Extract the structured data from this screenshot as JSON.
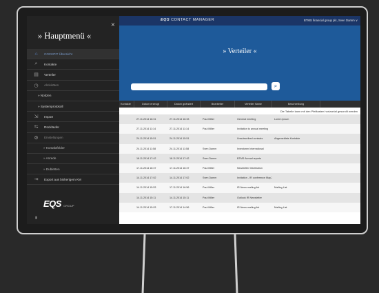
{
  "sidebar": {
    "title": "» Hauptmenü «",
    "close": "×",
    "items": [
      {
        "label": "COCKPIT Übersicht",
        "icon": "home-icon",
        "level": 0,
        "active": true
      },
      {
        "label": "Kontakte",
        "icon": "search-icon",
        "level": 0
      },
      {
        "label": "Verteiler",
        "icon": "list-icon",
        "level": 0
      },
      {
        "label": "Aktivitäten",
        "icon": "clock-icon",
        "level": 0,
        "dim": true
      },
      {
        "label": "» Notizen",
        "icon": "",
        "level": 1
      },
      {
        "label": "» Systemprotokoll",
        "icon": "",
        "level": 1
      },
      {
        "label": "Import",
        "icon": "import-icon",
        "level": 0
      },
      {
        "label": "Rückläufer",
        "icon": "bounce-icon",
        "level": 0
      },
      {
        "label": "Einstellungen",
        "icon": "gear-icon",
        "level": 0,
        "dim": true
      },
      {
        "label": "» Kontaktfelder",
        "icon": "",
        "level": 2
      },
      {
        "label": "» Anrede",
        "icon": "",
        "level": 2
      },
      {
        "label": "» Dubletten",
        "icon": "",
        "level": 2
      },
      {
        "label": "Export aus bisherigem KM",
        "icon": "export-icon",
        "level": 0
      }
    ],
    "logo": "EQS",
    "logo_sub": "GROUP"
  },
  "topbar": {
    "brand_bold": "EQS",
    "brand_rest": "CONTACT MANAGER",
    "user": "BTMS financial group plc, Sven Damm ∨"
  },
  "banner": {
    "title": "» Verteiler «",
    "search_placeholder": "",
    "search_icon": "🔍"
  },
  "table": {
    "headers": [
      "Kontakte",
      "Datum erzeugt",
      "Datum geändert",
      "Bearbeiter",
      "Verteiler Name",
      "Beschreibung"
    ],
    "notice": "Die Tabelle kann mit den Pfeiltasten horizontal gescrollt werden",
    "rows": [
      [
        "",
        "27.11.2014 16:31",
        "27.11.2014 16:33",
        "Paul Miller",
        "General meeting",
        "Lorem ipsum"
      ],
      [
        "",
        "27.11.2014 11:14",
        "27.11.2014 11:14",
        "Paul Miller",
        "Invitation to annual meeting",
        ""
      ],
      [
        "",
        "24.11.2014 15:51",
        "24.11.2014 15:51",
        "",
        "Unsubscribed contacts",
        "Abgemeldete Kontakte"
      ],
      [
        "",
        "24.11.2014 11:58",
        "24.11.2014 11:58",
        "Sven Damm",
        "Investoren International",
        ""
      ],
      [
        "",
        "18.11.2014 17:42",
        "18.11.2014 17:42",
        "Sven Damm",
        "BTMS Annual reports",
        ""
      ],
      [
        "",
        "17.11.2014 16:37",
        "17.11.2014 16:37",
        "Paul Miller",
        "Newsletter Distribution",
        ""
      ],
      [
        "",
        "14.11.2014 17:02",
        "14.11.2014 17:02",
        "Sven Damm",
        "Invitation - IR conference May 2015",
        ""
      ],
      [
        "",
        "14.11.2014 15:53",
        "17.11.2014 16:56",
        "Paul Miller",
        "IR News mailing list",
        "Mailing List"
      ],
      [
        "",
        "14.11.2014 15:11",
        "14.11.2014 15:11",
        "Paul Miller",
        "Outlook IR Newsletter",
        ""
      ],
      [
        "",
        "14.11.2014 15:03",
        "17.11.2014 14:56",
        "Paul Miller",
        "IR News mailing list",
        "Mailing List"
      ]
    ]
  }
}
